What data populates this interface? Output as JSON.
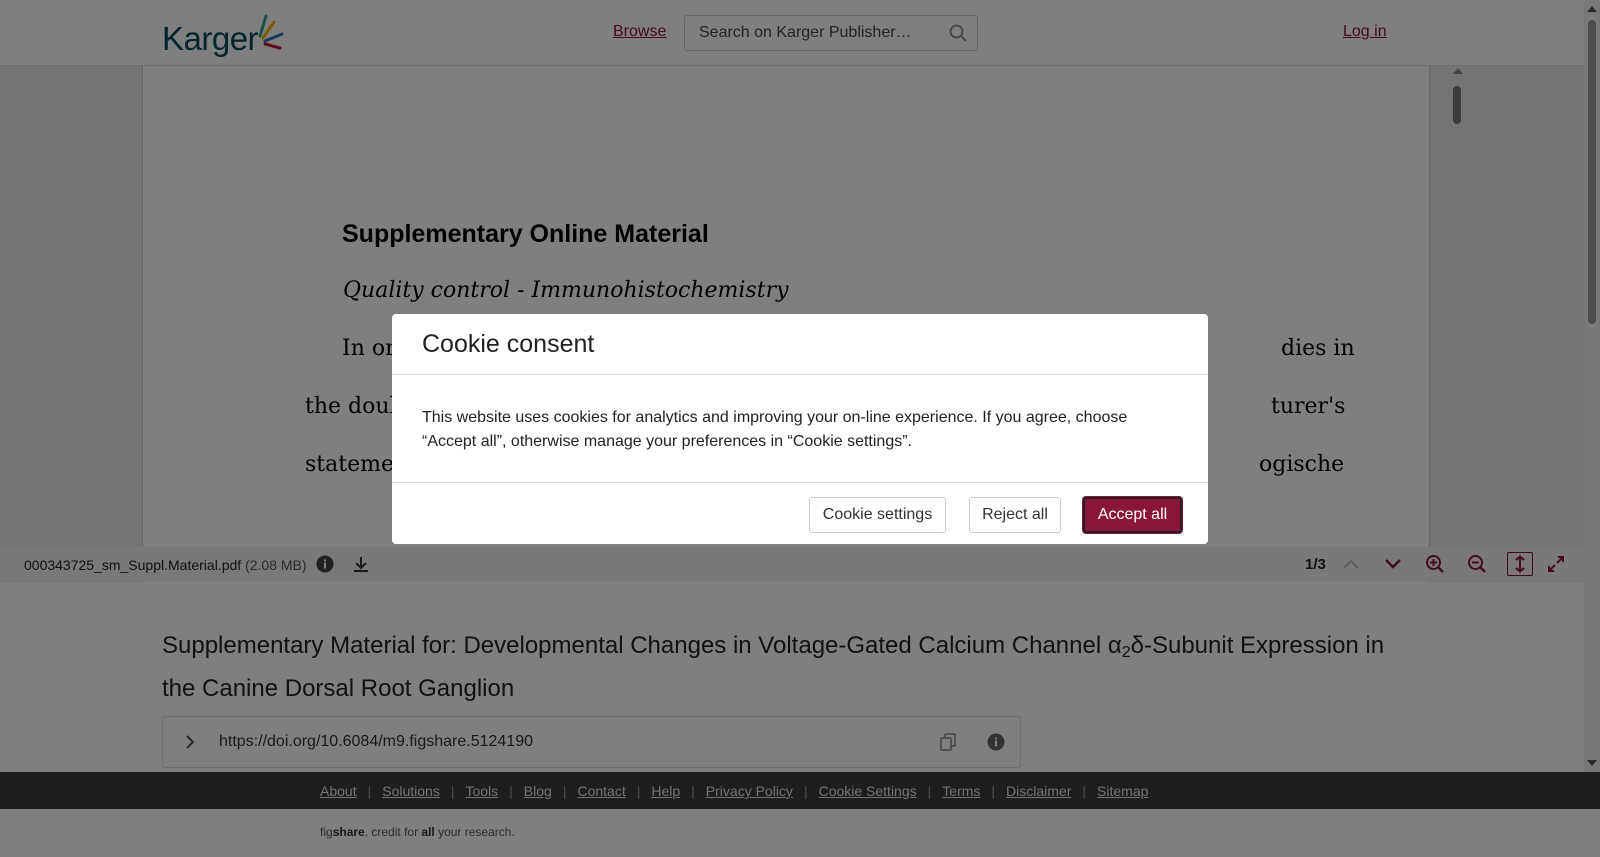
{
  "header": {
    "logo_text": "Karger",
    "browse_label": "Browse",
    "search_placeholder": "Search on Karger Publisher…",
    "login_label": "Log in"
  },
  "pdf": {
    "heading": "Supplementary Online Material",
    "subheading": "Quality control - Immunohistochemistry",
    "line1_start": "In or",
    "line1_end": "dies in",
    "line2_start": "the doub",
    "line2_end": "turer's",
    "line3_start": "statemen",
    "line3_end": "ogische"
  },
  "toolbar": {
    "filename": "000343725_sm_Suppl.Material.pdf",
    "filesize": "(2.08 MB)",
    "page_count": "1/3"
  },
  "article": {
    "title_part1": "Supplementary Material for: Developmental Changes in Voltage-Gated Calcium Channel α",
    "title_sub": "2",
    "title_part2": "δ-Subunit Expression in the Canine Dorsal Root Ganglion",
    "doi": "https://doi.org/10.6084/m9.figshare.5124190"
  },
  "footer": {
    "links": [
      "About",
      "Solutions",
      "Tools",
      "Blog",
      "Contact",
      "Help",
      "Privacy Policy",
      "Cookie Settings",
      "Terms",
      "Disclaimer",
      "Sitemap"
    ],
    "tagline_fig": "fig",
    "tagline_share": "share",
    "tagline_mid": ". credit for ",
    "tagline_all": "all",
    "tagline_end": " your research."
  },
  "cookie_modal": {
    "title": "Cookie consent",
    "body": "This website uses cookies for analytics and improving your on-line experience. If you agree, choose “Accept all”, otherwise manage your preferences in “Cookie settings”.",
    "settings_label": "Cookie settings",
    "reject_label": "Reject all",
    "accept_label": "Accept all"
  },
  "colors": {
    "brand": "#8a1538",
    "logo_teal": "#004b59",
    "footer_bg": "#3d3d3d"
  }
}
